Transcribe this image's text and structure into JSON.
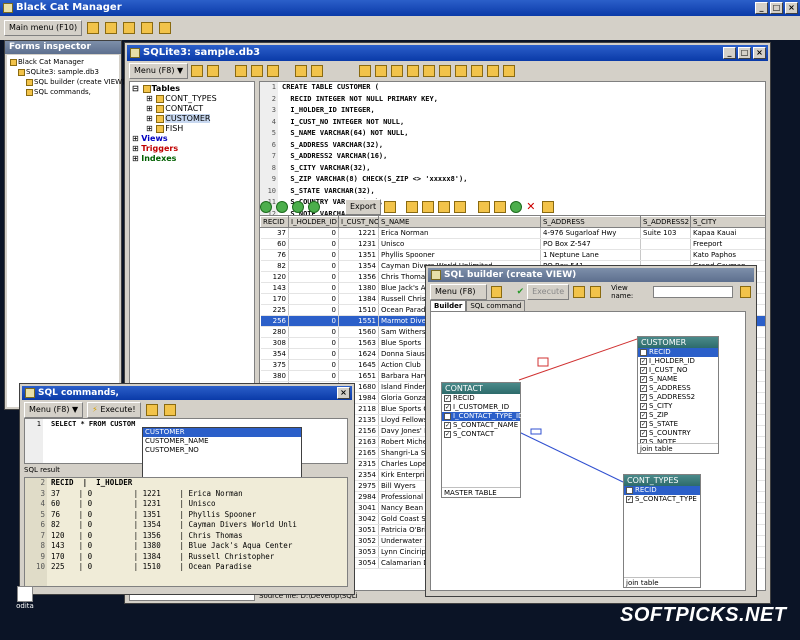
{
  "app": {
    "title": "Black Cat Manager",
    "menu_label": "Main menu (F10)"
  },
  "forms": {
    "title": "Forms inspector",
    "items": [
      "Black Cat Manager",
      "SQLite3: sample.db3",
      "SQL builder (create VIEW)",
      "SQL commands,"
    ]
  },
  "sqlite": {
    "title": "SQLite3: sample.db3",
    "menu_label": "Menu (F8)",
    "tree": {
      "tables": "Tables",
      "table_items": [
        "CONT_TYPES",
        "CONTACT",
        "CUSTOMER",
        "FISH"
      ],
      "views": "Views",
      "triggers": "Triggers",
      "indexes": "Indexes"
    },
    "code_lines": [
      "CREATE TABLE CUSTOMER (",
      "  RECID INTEGER NOT NULL PRIMARY KEY,",
      "  I_HOLDER_ID INTEGER,",
      "  I_CUST_NO INTEGER NOT NULL,",
      "  S_NAME VARCHAR(64) NOT NULL,",
      "  S_ADDRESS VARCHAR(32),",
      "  S_ADDRESS2 VARCHAR(16),",
      "  S_CITY VARCHAR(32),",
      "  S_ZIP VARCHAR(8) CHECK(S_ZIP <> 'xxxxx8'),",
      "  S_STATE VARCHAR(32),",
      "  S_COUNTRY VARCHAR(32),",
      "  S_NOTE VARCHAR(128)"
    ],
    "line_numbers": [
      "1",
      "2",
      "3",
      "4",
      "5",
      "6",
      "7",
      "8",
      "9",
      "10",
      "11",
      "12"
    ],
    "export_label": "Export",
    "grid_headers": [
      "RECID",
      "I_HOLDER_ID",
      "I_CUST_NO",
      "S_NAME",
      "S_ADDRESS",
      "S_ADDRESS2",
      "S_CITY"
    ],
    "grid_rows": [
      [
        "37",
        "0",
        "1221",
        "Erica Norman",
        "4-976 Sugarloaf Hwy",
        "Suite 103",
        "Kapaa Kauai"
      ],
      [
        "60",
        "0",
        "1231",
        "Unisco",
        "PO Box Z-547",
        "",
        "Freeport"
      ],
      [
        "76",
        "0",
        "1351",
        "Phyllis Spooner",
        "1 Neptune Lane",
        "",
        "Kato Paphos"
      ],
      [
        "82",
        "0",
        "1354",
        "Cayman Divers World Unlimited",
        "PO Box 541",
        "",
        "Grand Cayman"
      ],
      [
        "120",
        "0",
        "1356",
        "Chris Thomas",
        "",
        "",
        ""
      ],
      [
        "143",
        "0",
        "1380",
        "Blue Jack's A",
        "",
        "",
        ""
      ],
      [
        "170",
        "0",
        "1384",
        "Russell Christ",
        "",
        "",
        ""
      ],
      [
        "225",
        "0",
        "1510",
        "Ocean Parad",
        "",
        "",
        ""
      ],
      [
        "256",
        "0",
        "1551",
        "Marmot Diver",
        "",
        "",
        ""
      ],
      [
        "280",
        "0",
        "1560",
        "Sam Withersp",
        "",
        "",
        ""
      ],
      [
        "308",
        "0",
        "1563",
        "Blue Sports",
        "",
        "",
        ""
      ],
      [
        "354",
        "0",
        "1624",
        "Donna Siaus",
        "",
        "",
        ""
      ],
      [
        "375",
        "0",
        "1645",
        "Action Club",
        "",
        "",
        ""
      ],
      [
        "380",
        "0",
        "1651",
        "Barbara Harv",
        "",
        "",
        ""
      ],
      [
        "405",
        "0",
        "1680",
        "Island Finder",
        "",
        "",
        ""
      ],
      [
        "448",
        "0",
        "1984",
        "Gloria Gonzal",
        "",
        "",
        ""
      ],
      [
        "",
        "",
        "2118",
        "Blue Sports C",
        "",
        "",
        ""
      ],
      [
        "",
        "",
        "2135",
        "Lloyd Fellows",
        "",
        "",
        ""
      ],
      [
        "",
        "",
        "2156",
        "Davy Jones' L",
        "",
        "",
        ""
      ],
      [
        "",
        "",
        "2163",
        "Robert Miche",
        "",
        "",
        ""
      ],
      [
        "",
        "",
        "2165",
        "Shangri-La Sp",
        "",
        "",
        ""
      ],
      [
        "",
        "",
        "2315",
        "Charles Lope",
        "",
        "",
        ""
      ],
      [
        "",
        "",
        "2354",
        "Kirk Enterpris",
        "",
        "",
        ""
      ],
      [
        "",
        "",
        "2975",
        "Bill Wyers",
        "",
        "",
        ""
      ],
      [
        "",
        "",
        "2984",
        "Professional D",
        "",
        "",
        ""
      ],
      [
        "",
        "",
        "3041",
        "Nancy Bean",
        "",
        "",
        ""
      ],
      [
        "",
        "",
        "3042",
        "Gold Coast Su",
        "",
        "",
        ""
      ],
      [
        "",
        "",
        "3051",
        "Patricia O'Bri",
        "",
        "",
        ""
      ],
      [
        "",
        "",
        "3052",
        "Underwater S",
        "",
        "",
        ""
      ],
      [
        "",
        "",
        "3053",
        "Lynn Cincirip",
        "",
        "",
        ""
      ],
      [
        "",
        "",
        "3054",
        "Calamarian Di",
        "",
        "",
        ""
      ]
    ],
    "status": "Source file: D:\\Develop\\SQLi"
  },
  "builder": {
    "title": "SQL builder (create VIEW)",
    "menu_label": "Menu (F8)",
    "execute_label": "Execute",
    "view_name_label": "View name:",
    "view_name_value": "",
    "tabs": [
      "Builder",
      "SQL command"
    ],
    "customer": {
      "name": "CUSTOMER",
      "fields": [
        "RECID",
        "I_HOLDER_ID",
        "I_CUST_NO",
        "S_NAME",
        "S_ADDRESS",
        "S_ADDRESS2",
        "S_CITY",
        "S_ZIP",
        "S_STATE",
        "S_COUNTRY",
        "S_NOTE"
      ],
      "footer": "join table"
    },
    "contact": {
      "name": "CONTACT",
      "fields": [
        "RECID",
        "I_CUSTOMER_ID",
        "I_CONTACT_TYPE_ID",
        "S_CONTACT_NAME",
        "S_CONTACT"
      ],
      "footer": "MASTER TABLE"
    },
    "cont_types": {
      "name": "CONT_TYPES",
      "fields": [
        "RECID",
        "S_CONTACT_TYPE"
      ],
      "footer": "join table"
    }
  },
  "sqlcmd": {
    "title": "SQL commands,",
    "menu_label": "Menu (F8)",
    "execute_label": "Execute!",
    "query": "SELECT * FROM CUSTOM",
    "line_no": "1",
    "autocomplete": [
      "CUSTOMER",
      "CUSTOMER_NAME",
      "CUSTOMER_NO"
    ],
    "result_label": "SQL result",
    "headers": [
      "RECID",
      "I_HOLDER"
    ],
    "rows": [
      {
        "a": "37",
        "b": "0",
        "c": "1221",
        "d": "Erica Norman"
      },
      {
        "a": "60",
        "b": "0",
        "c": "1231",
        "d": "Unisco"
      },
      {
        "a": "76",
        "b": "0",
        "c": "1351",
        "d": "Phyllis Spooner"
      },
      {
        "a": "82",
        "b": "0",
        "c": "1354",
        "d": "Cayman Divers World Unli"
      },
      {
        "a": "120",
        "b": "0",
        "c": "1356",
        "d": "Chris Thomas"
      },
      {
        "a": "143",
        "b": "0",
        "c": "1380",
        "d": "Blue Jack's Aqua Center"
      },
      {
        "a": "170",
        "b": "0",
        "c": "1384",
        "d": "Russell Christopher"
      },
      {
        "a": "225",
        "b": "0",
        "c": "1510",
        "d": "Ocean Paradise"
      }
    ],
    "row_numbers": [
      "2",
      "3",
      "4",
      "5",
      "6",
      "7",
      "8",
      "9",
      "10"
    ]
  },
  "desktop": {
    "icon_label": "odita",
    "watermark": "SOFTPICKS.NET"
  }
}
